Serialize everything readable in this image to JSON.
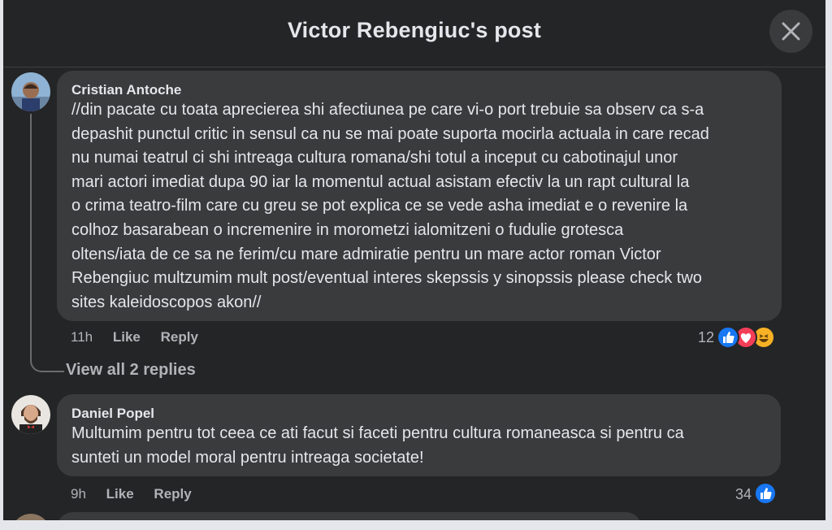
{
  "dialog": {
    "title": "Victor Rebengiuc's post",
    "close_label": "×"
  },
  "comments": [
    {
      "author": "Cristian Antoche",
      "text": "//din pacate cu toata aprecierea shi afectiunea pe care vi-o port trebuie sa observ ca s-a\ndepashit punctul critic in sensul ca nu se mai poate suporta mocirla actuala in care recad\nnu numai teatrul ci shi intreaga cultura romana/shi totul a inceput cu cabotinajul unor\nmari actori imediat dupa 90 iar la momentul actual asistam efectiv la un rapt cultural la\no crima teatro-film care cu greu se pot explica ce se vede asha imediat e o revenire la\ncolhoz basarabean o incremenire in morometzi ialomitzeni o fudulie grotesca\noltens/iata de ce sa ne ferim/cu mare admiratie pentru un mare actor roman Victor\nRebengiuc multzumim mult post/eventual interes skepssis y sinopssis please check two\nsites kaleidoscopos akon//",
      "time": "11h",
      "like": "Like",
      "reply": "Reply",
      "reaction_count": "12",
      "reactions": [
        "like-icon",
        "love-icon",
        "haha-icon"
      ],
      "view_replies": "View all 2 replies"
    },
    {
      "author": "Daniel Popel",
      "text": "Multumim pentru tot ceea ce ati facut si faceti pentru cultura romaneasca si pentru ca\nsunteti un model moral pentru intreaga societate!",
      "time": "9h",
      "like": "Like",
      "reply": "Reply",
      "reaction_count": "34",
      "reactions": [
        "like-icon"
      ]
    }
  ],
  "colors": {
    "background": "#242526",
    "bubble": "#3a3b3c",
    "text": "#e4e6eb",
    "secondary": "#b0b3b8",
    "like_blue": "#1877f2",
    "love_red": "#f33e58",
    "haha_yellow": "#f7b125"
  }
}
